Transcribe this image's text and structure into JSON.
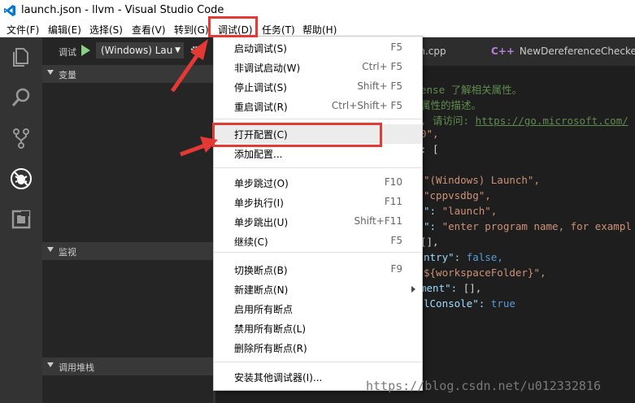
{
  "window": {
    "title": "launch.json - llvm - Visual Studio Code"
  },
  "menubar": {
    "file": "文件(F)",
    "edit": "编辑(E)",
    "selection": "选择(S)",
    "view": "查看(V)",
    "goto": "转到(G)",
    "debug": "调试(D)",
    "tasks": "任务(T)",
    "help": "帮助(H)"
  },
  "sidebar": {
    "debug_label": "调试",
    "config_selected": "(Windows) Lau",
    "sections": {
      "variables": "变量",
      "watch": "监视",
      "callstack": "调用堆栈"
    }
  },
  "activity_icons": [
    "files-icon",
    "search-icon",
    "source-control-icon",
    "debug-icon",
    "extensions-icon"
  ],
  "tabs": {
    "tab1": "on.cpp",
    "tab2": "NewDereferenceChecker.cp",
    "tab2_icon": "C++"
  },
  "code_lines": [
    {
      "parts": [
        {
          "t": "ense 了解相关属性。",
          "c": "#608b4e"
        }
      ]
    },
    {
      "parts": [
        {
          "t": "属性的描述。",
          "c": "#608b4e"
        }
      ]
    },
    {
      "parts": [
        {
          "t": ", 请访问: ",
          "c": "#608b4e"
        },
        {
          "t": "https://go.microsoft.com/",
          "c": "#608b4e",
          "u": true
        }
      ]
    },
    {
      "parts": [
        {
          "t": "0\",",
          "c": "#ce9178"
        }
      ]
    },
    {
      "parts": [
        {
          "t": ": [",
          "c": "#d4d4d4"
        }
      ]
    },
    {
      "parts": [
        {
          "t": "",
          "c": "#d4d4d4"
        }
      ]
    },
    {
      "parts": [
        {
          "t": "\"(Windows) Launch\",",
          "c": "#ce9178"
        }
      ]
    },
    {
      "parts": [
        {
          "t": "\"cppvsdbg\",",
          "c": "#ce9178"
        }
      ]
    },
    {
      "parts": [
        {
          "t": "\": ",
          "c": "#9cdcfe"
        },
        {
          "t": "\"launch\",",
          "c": "#ce9178"
        }
      ]
    },
    {
      "parts": [
        {
          "t": "\": ",
          "c": "#9cdcfe"
        },
        {
          "t": "\"enter program name, for exampl",
          "c": "#ce9178"
        }
      ]
    },
    {
      "parts": [
        {
          "t": "[],",
          "c": "#d4d4d4"
        }
      ]
    },
    {
      "parts": [
        {
          "t": "ntry\": ",
          "c": "#9cdcfe"
        },
        {
          "t": "false,",
          "c": "#569cd6"
        }
      ]
    },
    {
      "parts": [
        {
          "t": "${workspaceFolder}\",",
          "c": "#ce9178"
        }
      ]
    },
    {
      "parts": [
        {
          "t": "ment\": ",
          "c": "#9cdcfe"
        },
        {
          "t": "[],",
          "c": "#d4d4d4"
        }
      ]
    },
    {
      "parts": [
        {
          "t": "lConsole\": ",
          "c": "#9cdcfe"
        },
        {
          "t": "true",
          "c": "#569cd6"
        }
      ]
    }
  ],
  "debug_menu": {
    "items": [
      {
        "label": "启动调试(S)",
        "shortcut": "F5"
      },
      {
        "label": "非调试启动(W)",
        "shortcut": "Ctrl+ F5"
      },
      {
        "label": "停止调试(S)",
        "shortcut": "Shift+ F5"
      },
      {
        "label": "重启调试(R)",
        "shortcut": "Ctrl+Shift+ F5"
      },
      {
        "label": "打开配置(C)",
        "shortcut": ""
      },
      {
        "label": "添加配置...",
        "shortcut": ""
      },
      {
        "label": "单步跳过(O)",
        "shortcut": "F10"
      },
      {
        "label": "单步执行(I)",
        "shortcut": "F11"
      },
      {
        "label": "单步跳出(U)",
        "shortcut": "Shift+F11"
      },
      {
        "label": "继续(C)",
        "shortcut": "F5"
      },
      {
        "label": "切换断点(B)",
        "shortcut": "F9"
      },
      {
        "label": "新建断点(N)",
        "shortcut": ""
      },
      {
        "label": "启用所有断点",
        "shortcut": ""
      },
      {
        "label": "禁用所有断点(L)",
        "shortcut": ""
      },
      {
        "label": "删除所有断点(R)",
        "shortcut": ""
      },
      {
        "label": "安装其他调试器(I)...",
        "shortcut": ""
      }
    ]
  },
  "watermark": "https://blog.csdn.net/u012332816",
  "colors": {
    "highlight": "#e53935",
    "accent": "#007acc",
    "run": "#89d185"
  }
}
